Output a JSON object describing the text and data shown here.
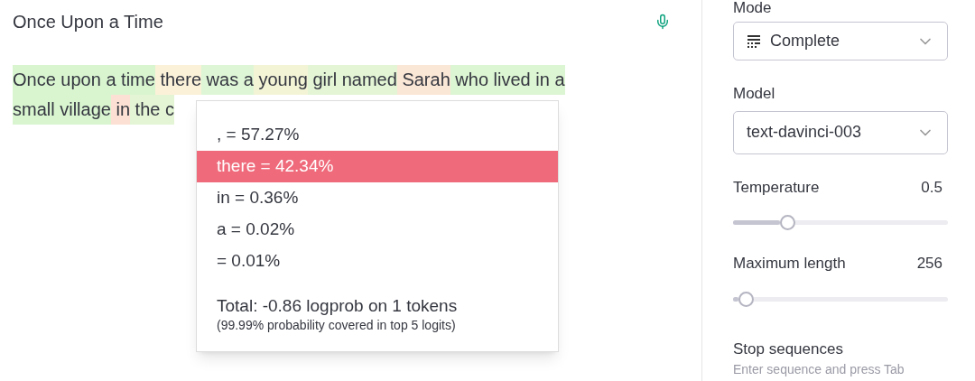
{
  "editor": {
    "title": "Once Upon a Time",
    "lines": [
      [
        {
          "text": "Once upon a time",
          "color": "#d9f5d0"
        },
        {
          "text": " there",
          "color": "#fbf1d9"
        },
        {
          "text": " was a",
          "color": "#dff6d6"
        },
        {
          "text": " young",
          "color": "#f3f4d6"
        },
        {
          "text": " girl named",
          "color": "#e3f5d4"
        },
        {
          "text": " Sarah",
          "color": "#fbe7d6"
        },
        {
          "text": " who lived in a",
          "color": "#dcf5d2"
        }
      ],
      [
        {
          "text": "small village",
          "color": "#d9f5d0"
        },
        {
          "text": " in",
          "color": "#fbe0d3"
        },
        {
          "text": " the c",
          "color": "#e3f5d4"
        }
      ]
    ]
  },
  "popup": {
    "items": [
      {
        "label": ", = 57.27%",
        "selected": false
      },
      {
        "label": "there = 42.34%",
        "selected": true
      },
      {
        "label": "in = 0.36%",
        "selected": false
      },
      {
        "label": "a = 0.02%",
        "selected": false
      },
      {
        "label": "= 0.01%",
        "selected": false
      }
    ],
    "total": "Total: -0.86 logprob on 1 tokens",
    "note": "(99.99% probability covered in top 5 logits)"
  },
  "sidebar": {
    "mode_label": "Mode",
    "mode_value": "Complete",
    "model_label": "Model",
    "model_value": "text-davinci-003",
    "sliders": [
      {
        "label": "Temperature",
        "reading": "0.5",
        "level": 0.25
      },
      {
        "label": "Maximum length",
        "reading": "256",
        "level": 0.06
      }
    ],
    "stop_label": "Stop sequences",
    "stop_hint": "Enter sequence and press Tab"
  }
}
